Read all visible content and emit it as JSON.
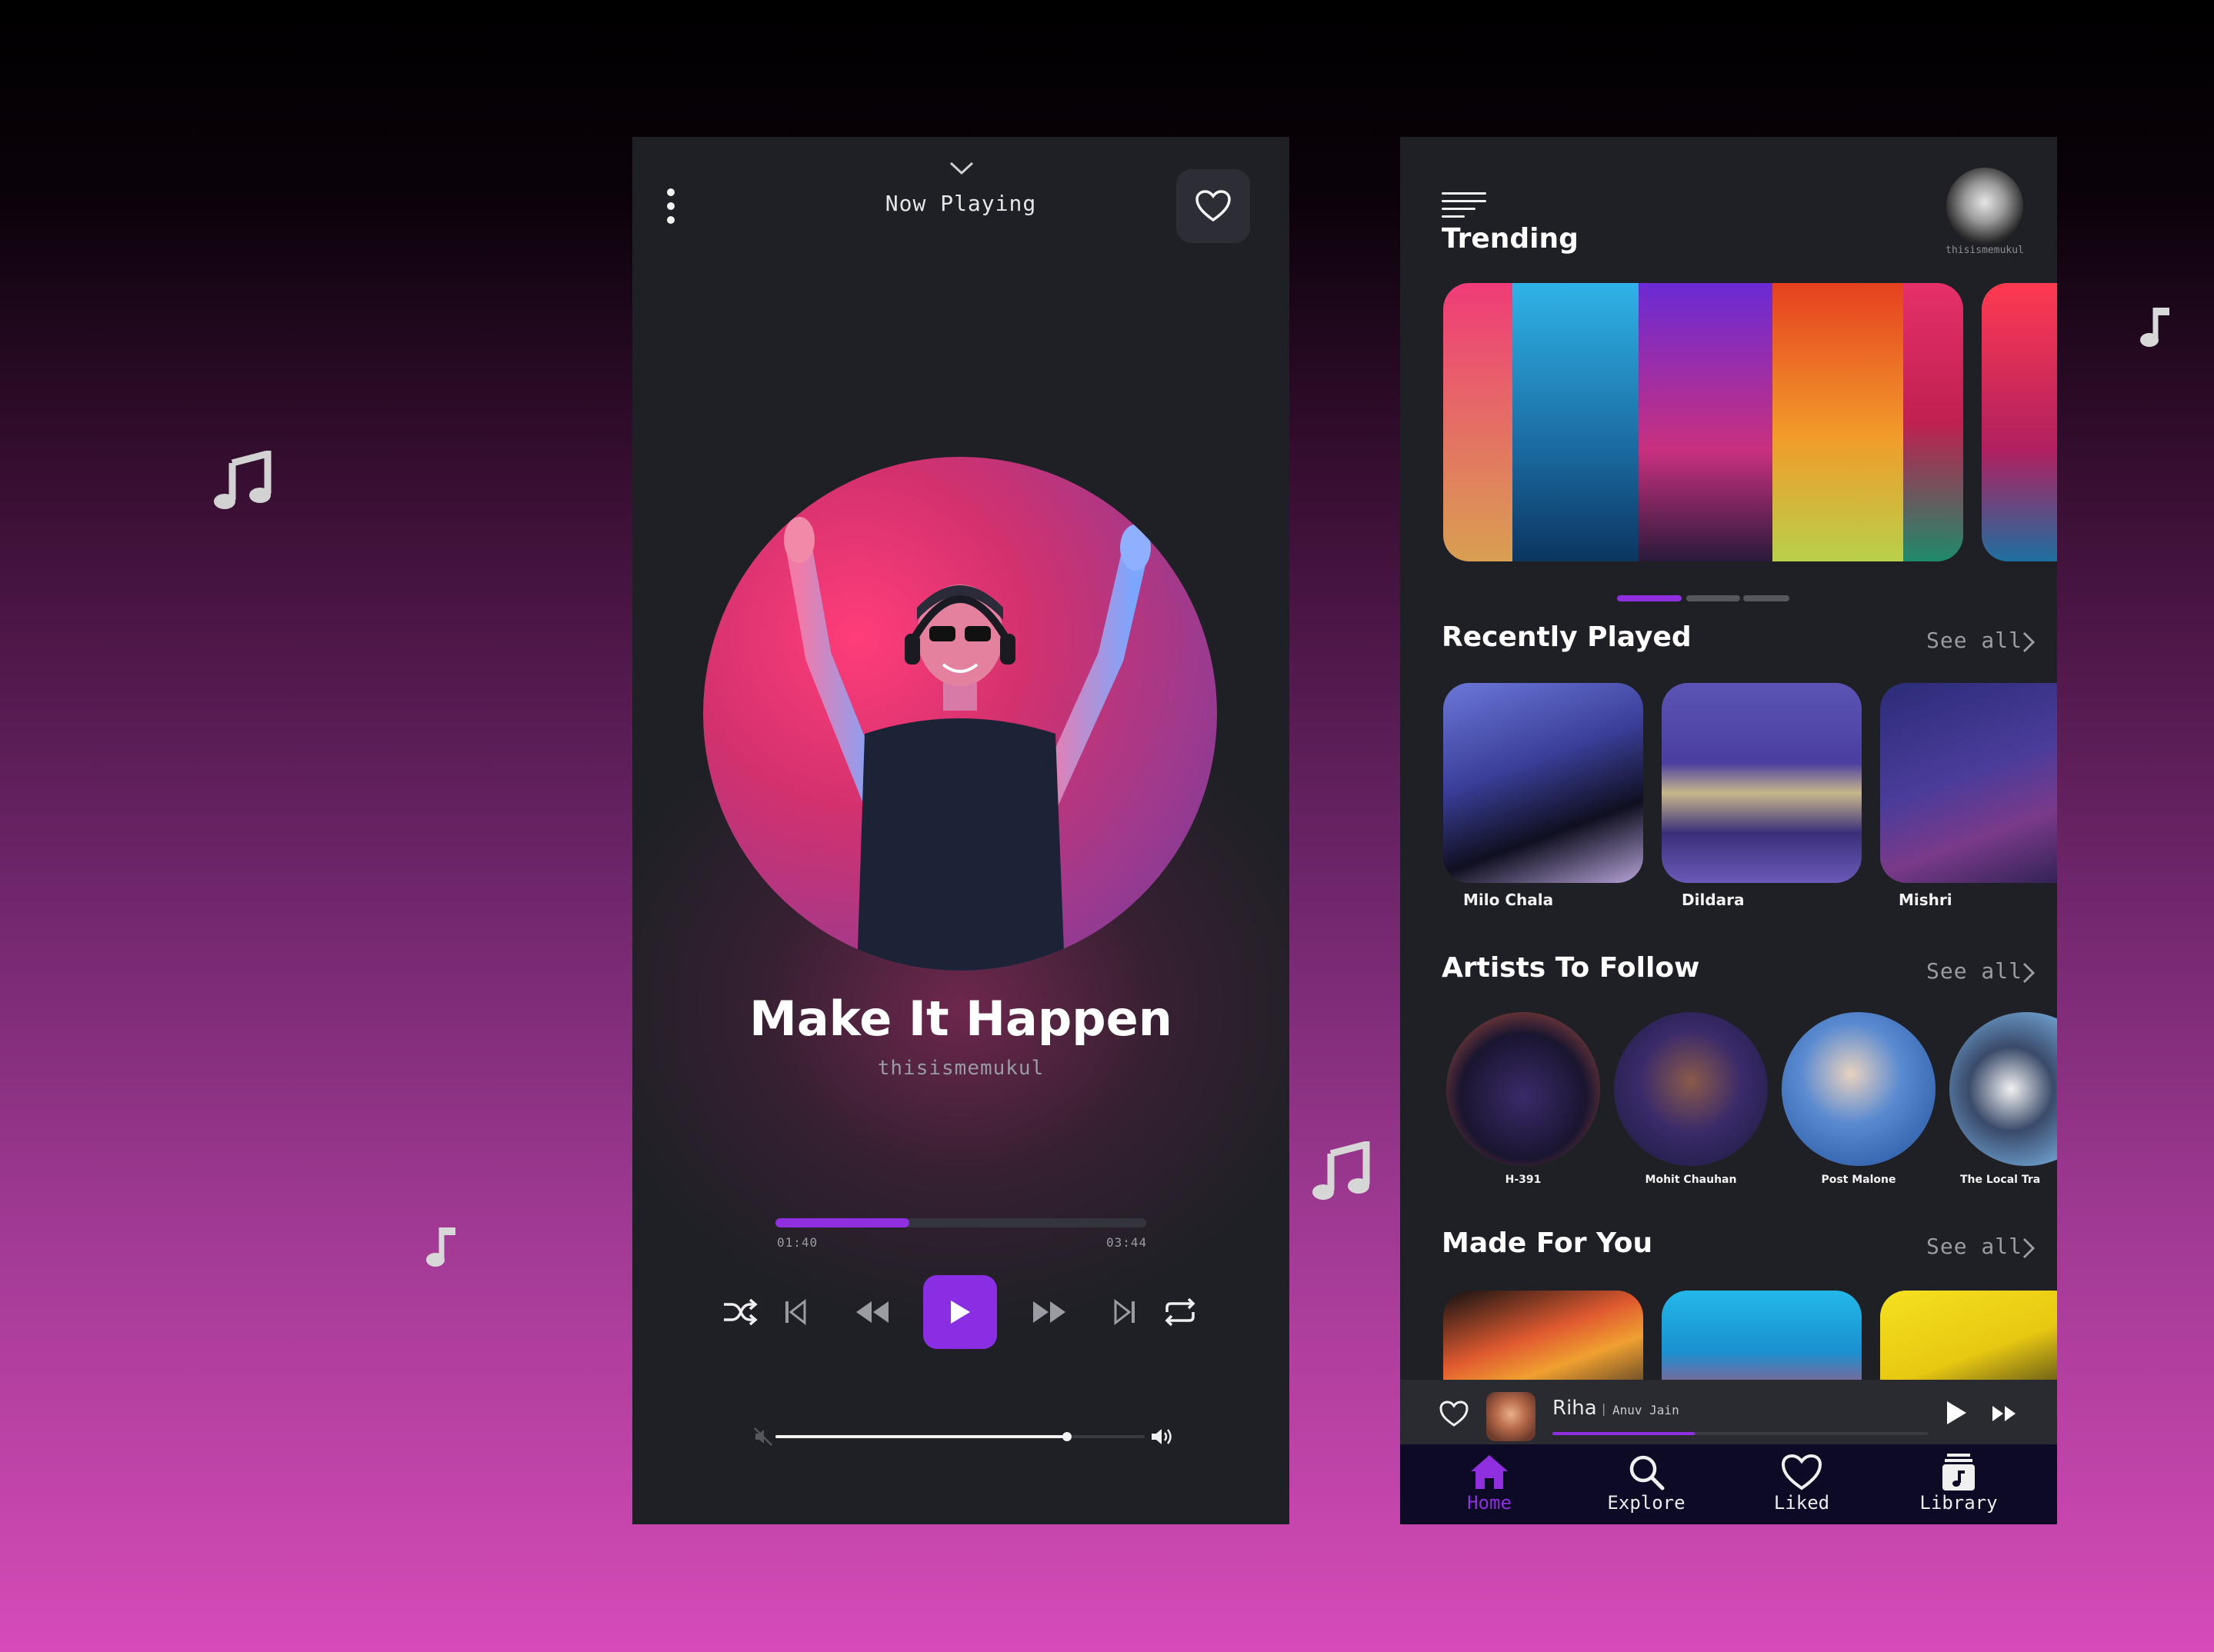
{
  "player": {
    "header_title": "Now Playing",
    "song_title": "Make It Happen",
    "artist": "thisismemukul",
    "progress": 0.36,
    "current_time": "01:40",
    "total_time": "03:44",
    "volume": 0.79,
    "accent": "#8a2ee3"
  },
  "home": {
    "profile_name": "thisismemukul",
    "trending_title": "Trending",
    "trending_page": 1,
    "trending_pages": 3,
    "recently_played": {
      "title": "Recently Played",
      "see_all": "See all",
      "items": [
        "Milo Chala",
        "Dildara",
        "Mishri"
      ]
    },
    "artists": {
      "title": "Artists To Follow",
      "see_all": "See all",
      "items": [
        "H-391",
        "Mohit Chauhan",
        "Post Malone",
        "The Local Tra"
      ]
    },
    "made_for_you": {
      "title": "Made For You",
      "see_all": "See all"
    },
    "mini_player": {
      "title": "Riha",
      "artist": "Anuv Jain",
      "progress": 0.38
    },
    "tabs": [
      {
        "label": "Home",
        "icon": "home-icon",
        "active": true
      },
      {
        "label": "Explore",
        "icon": "search-icon",
        "active": false
      },
      {
        "label": "Liked",
        "icon": "heart-icon",
        "active": false
      },
      {
        "label": "Library",
        "icon": "library-icon",
        "active": false
      }
    ]
  },
  "colors": {
    "accent": "#8f2fe0",
    "panel": "#1f2026",
    "tabbar": "#0c0a24"
  }
}
